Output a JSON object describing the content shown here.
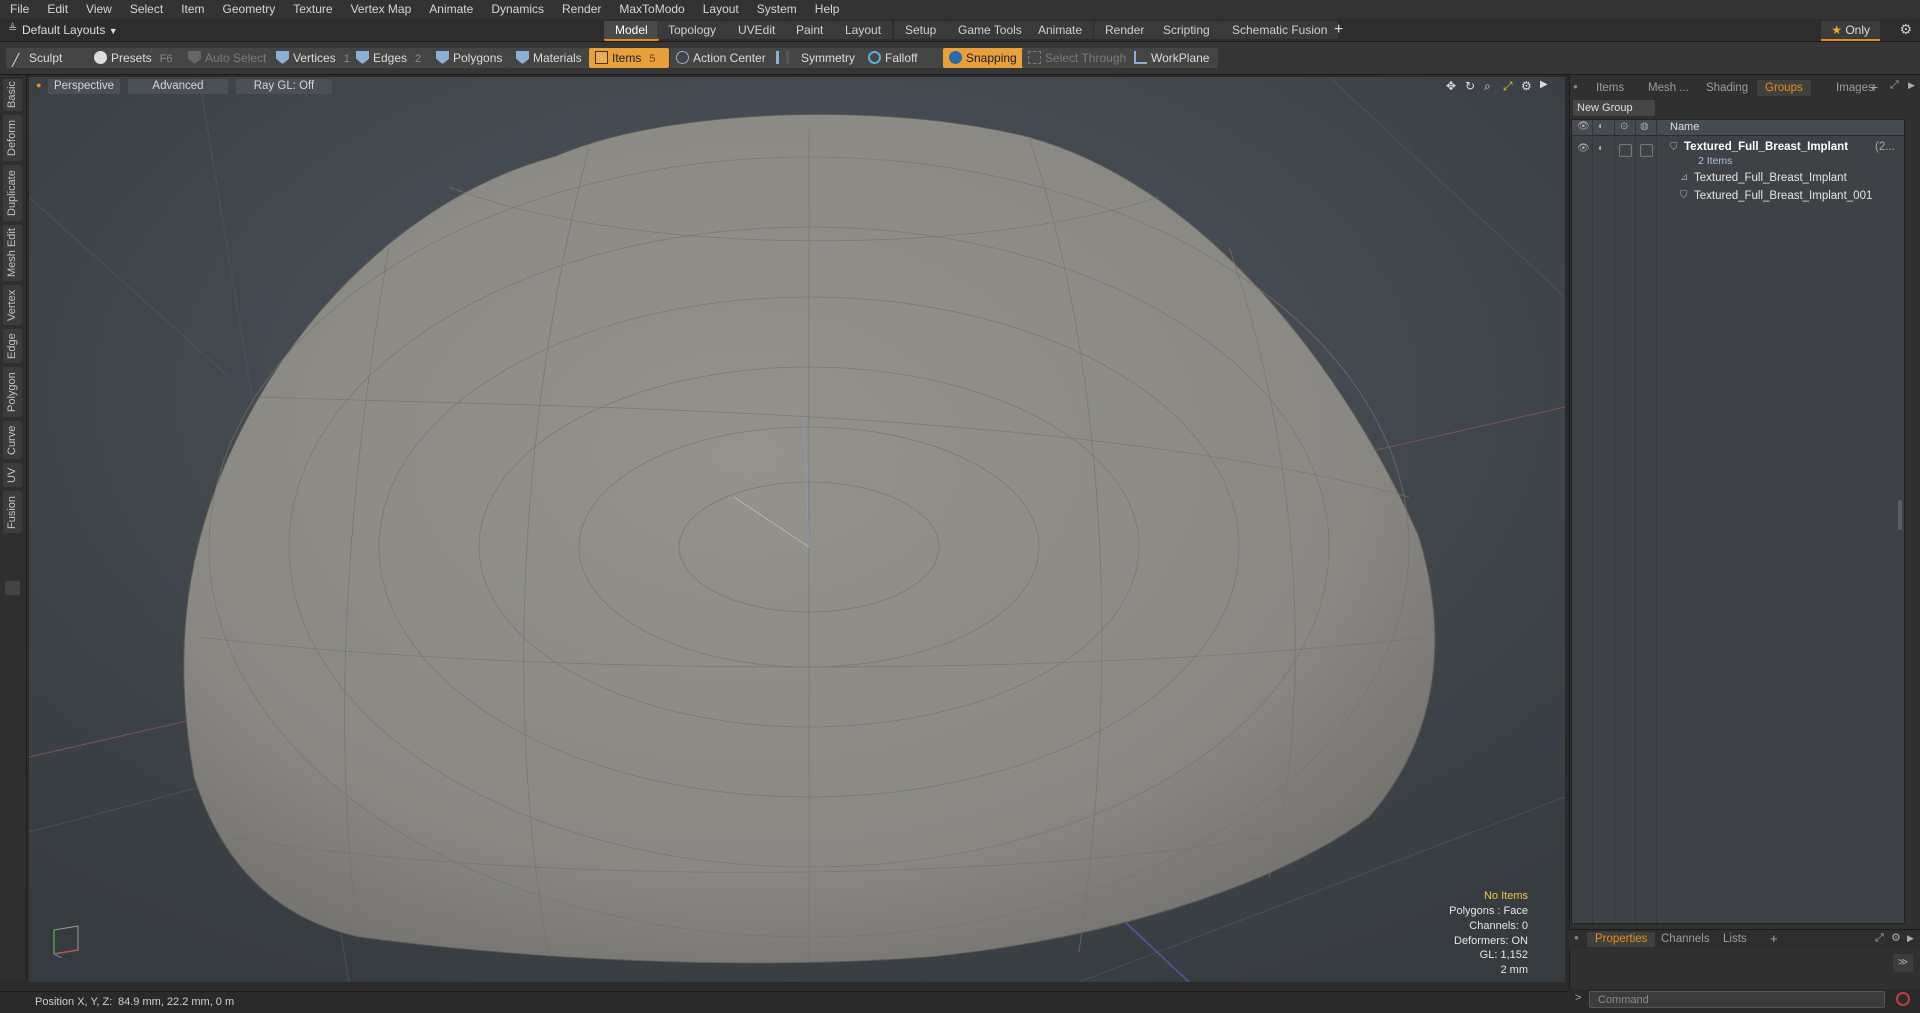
{
  "menu": [
    "File",
    "Edit",
    "View",
    "Select",
    "Item",
    "Geometry",
    "Texture",
    "Vertex Map",
    "Animate",
    "Dynamics",
    "Render",
    "MaxToModo",
    "Layout",
    "System",
    "Help"
  ],
  "layouts_dropdown": "Default Layouts",
  "layout_tabs": [
    "Model",
    "Topology",
    "UVEdit",
    "Paint",
    "Layout",
    "Setup",
    "Game Tools",
    "Animate",
    "Render",
    "Scripting",
    "Schematic Fusion"
  ],
  "active_layout_tab": "Model",
  "only_label": "Only",
  "toolbar": {
    "sculpt": "Sculpt",
    "presets": "Presets",
    "presets_key": "F6",
    "auto_select": "Auto Select",
    "vertices": "Vertices",
    "vertices_count": "1",
    "edges": "Edges",
    "edges_count": "2",
    "polygons": "Polygons",
    "materials": "Materials",
    "items": "Items",
    "items_count": "5",
    "action_center": "Action Center",
    "symmetry": "Symmetry",
    "falloff": "Falloff",
    "snapping": "Snapping",
    "select_through": "Select Through",
    "workplane": "WorkPlane"
  },
  "left_tabs": [
    "Basic",
    "Deform",
    "Duplicate",
    "Mesh Edit",
    "Vertex",
    "Edge",
    "Polygon",
    "Curve",
    "UV",
    "Fusion"
  ],
  "viewport": {
    "perspective": "Perspective",
    "advanced": "Advanced",
    "raygl": "Ray GL: Off",
    "info": {
      "no_items": "No Items",
      "polygons": "Polygons : Face",
      "channels": "Channels: 0",
      "deformers": "Deformers: ON",
      "gl": "GL: 1,152",
      "unit": "2 mm"
    }
  },
  "status": {
    "position_label": "Position X, Y, Z:",
    "position_value": "84.9 mm, 22.2 mm, 0 m"
  },
  "right_panel": {
    "tabs": [
      "Items",
      "Mesh ...",
      "Shading",
      "Groups",
      "Images"
    ],
    "active_tab": "Groups",
    "new_group": "New Group",
    "name_header": "Name",
    "group_name": "Textured_Full_Breast_Implant",
    "group_count_suffix": "(2...",
    "group_items": "2 Items",
    "children": [
      "Textured_Full_Breast_Implant",
      "Textured_Full_Breast_Implant_001"
    ],
    "bottom_tabs": [
      "Properties",
      "Channels",
      "Lists"
    ],
    "bottom_active": "Properties",
    "command_placeholder": "Command"
  },
  "colors": {
    "accent": "#e88d14",
    "viewport_bg": "#3f454b",
    "mesh_fill": "#8a8984"
  }
}
